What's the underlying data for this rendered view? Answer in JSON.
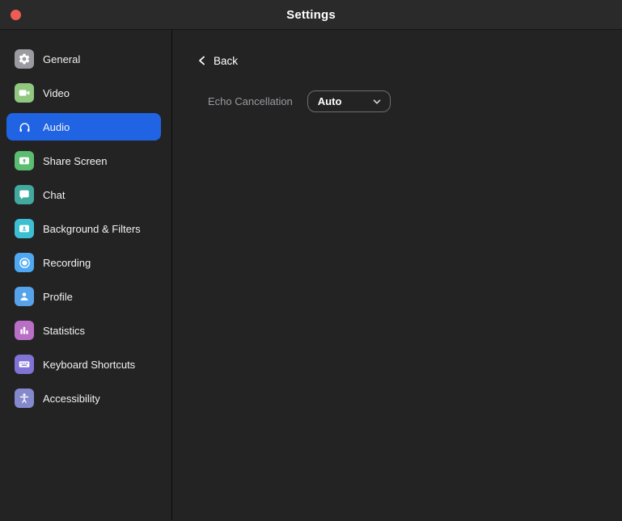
{
  "window": {
    "title": "Settings"
  },
  "titlebar": {
    "close_color": "#ee5d54"
  },
  "sidebar": {
    "selected_bg": "#2064e4",
    "items": [
      {
        "label": "General",
        "icon": "gear",
        "icon_color": "#9a9aa0"
      },
      {
        "label": "Video",
        "icon": "video-camera",
        "icon_color": "#8fc87e"
      },
      {
        "label": "Audio",
        "icon": "headphones",
        "icon_color": "#2064e4",
        "selected": true
      },
      {
        "label": "Share Screen",
        "icon": "share-screen",
        "icon_color": "#5abd6f"
      },
      {
        "label": "Chat",
        "icon": "chat-bubble",
        "icon_color": "#42a99e"
      },
      {
        "label": "Background & Filters",
        "icon": "person-frame",
        "icon_color": "#3cbfd3"
      },
      {
        "label": "Recording",
        "icon": "record",
        "icon_color": "#4fa9f2"
      },
      {
        "label": "Profile",
        "icon": "person",
        "icon_color": "#57a3ea"
      },
      {
        "label": "Statistics",
        "icon": "bar-chart",
        "icon_color": "#ba6fc6"
      },
      {
        "label": "Keyboard Shortcuts",
        "icon": "keyboard",
        "icon_color": "#8172d6"
      },
      {
        "label": "Accessibility",
        "icon": "accessibility",
        "icon_color": "#8489cb"
      }
    ]
  },
  "main": {
    "back_label": "Back",
    "field_label": "Echo Cancellation",
    "dropdown_value": "Auto"
  }
}
